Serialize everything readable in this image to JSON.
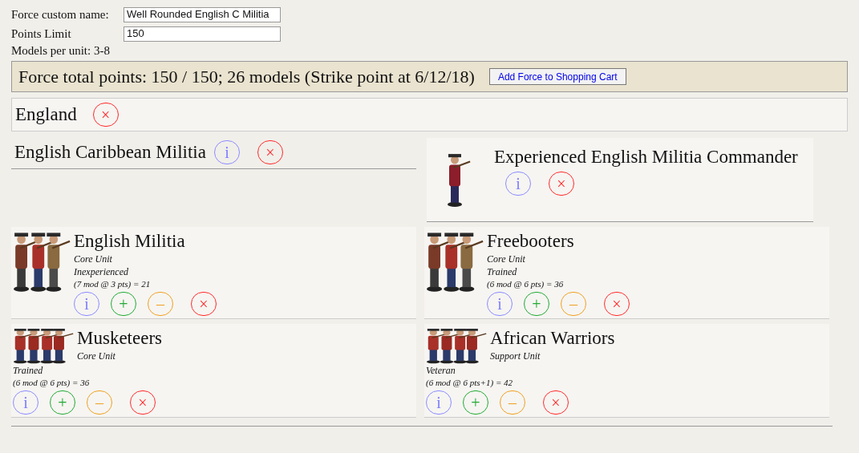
{
  "form": [
    {
      "label": "Force custom name:",
      "value": "Well Rounded English C Militia"
    },
    {
      "label": "Points Limit",
      "value": "150"
    }
  ],
  "models_per_unit": "Models per unit: 3-8",
  "total": {
    "text": "Force total points: 150 / 150; 26 models (Strike point at 6/12/18)",
    "button": "Add Force to Shopping Cart"
  },
  "faction": {
    "name": "England",
    "buttons": [
      {
        "kind": "remove",
        "label": "×"
      }
    ]
  },
  "units": [
    {
      "kind": "header",
      "name": "English Caribbean Militia",
      "buttons": [
        {
          "kind": "info",
          "label": "i"
        },
        {
          "kind": "remove",
          "label": "×"
        }
      ]
    },
    {
      "kind": "commander",
      "name": "Experienced English Militia Commander",
      "buttons": [
        {
          "kind": "info",
          "label": "i"
        },
        {
          "kind": "remove",
          "label": "×"
        }
      ]
    },
    {
      "kind": "unit",
      "name": "English Militia",
      "type": "Core Unit",
      "experience": "Inexperienced",
      "cost": "(7 mod @ 3 pts) = 21",
      "buttons": [
        {
          "kind": "info",
          "label": "i"
        },
        {
          "kind": "add",
          "label": "+"
        },
        {
          "kind": "subtract",
          "label": "–"
        },
        {
          "kind": "remove",
          "label": "×"
        }
      ]
    },
    {
      "kind": "unit",
      "name": "Freebooters",
      "type": "Core Unit",
      "experience": "Trained",
      "cost": "(6 mod @ 6 pts) = 36",
      "buttons": [
        {
          "kind": "info",
          "label": "i"
        },
        {
          "kind": "add",
          "label": "+"
        },
        {
          "kind": "subtract",
          "label": "–"
        },
        {
          "kind": "remove",
          "label": "×"
        }
      ]
    },
    {
      "kind": "wide_unit",
      "name": "Musketeers",
      "type": "Core Unit",
      "experience": "Trained",
      "cost": "(6 mod @ 6 pts) = 36",
      "buttons": [
        {
          "kind": "info",
          "label": "i"
        },
        {
          "kind": "add",
          "label": "+"
        },
        {
          "kind": "subtract",
          "label": "–"
        },
        {
          "kind": "remove",
          "label": "×"
        }
      ]
    },
    {
      "kind": "wide_unit",
      "name": "African Warriors",
      "type": "Support Unit",
      "experience": "Veteran",
      "cost": "(6 mod @ 6 pts+1) = 42",
      "buttons": [
        {
          "kind": "info",
          "label": "i"
        },
        {
          "kind": "add",
          "label": "+"
        },
        {
          "kind": "subtract",
          "label": "–"
        },
        {
          "kind": "remove",
          "label": "×"
        }
      ]
    }
  ]
}
